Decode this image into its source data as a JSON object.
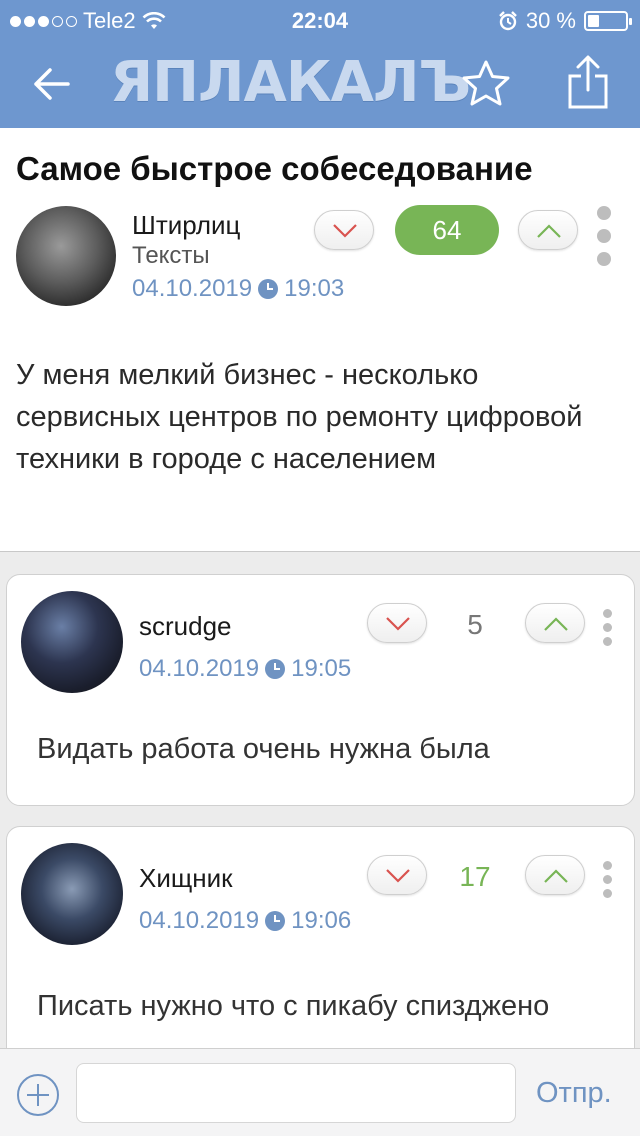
{
  "status_bar": {
    "carrier": "Tele2",
    "time": "22:04",
    "battery_percent": "30 %",
    "battery_level": 0.3,
    "signal_bars_filled": 3,
    "signal_bars_total": 5
  },
  "nav": {
    "logo_text": "ЯПЛАКАЛЪ",
    "back_icon": "arrow-left-icon",
    "favorite_icon": "star-icon",
    "share_icon": "share-icon"
  },
  "post": {
    "title": "Самое быстрое собеседование",
    "author": "Штирлиц",
    "category": "Тексты",
    "date": "04.10.2019",
    "time": "19:03",
    "score": "64",
    "body": "У меня мелкий бизнес - несколько сервисных центров по ремонту цифровой техники в городе с населением"
  },
  "comments": [
    {
      "author": "scrudge",
      "date": "04.10.2019",
      "time": "19:05",
      "score": "5",
      "body": "Видать работа очень нужна была"
    },
    {
      "author": "Хищник",
      "date": "04.10.2019",
      "time": "19:06",
      "score": "17",
      "body": "Писать нужно что с пикабу спиздженo"
    }
  ],
  "input_bar": {
    "placeholder": "",
    "send_label": "Отпр."
  },
  "colors": {
    "header": "#6e97cf",
    "accent_blue": "#6f93c2",
    "score_green": "#78b556",
    "score_text_positive": "#78b556",
    "score_text_neutral": "#777777"
  }
}
